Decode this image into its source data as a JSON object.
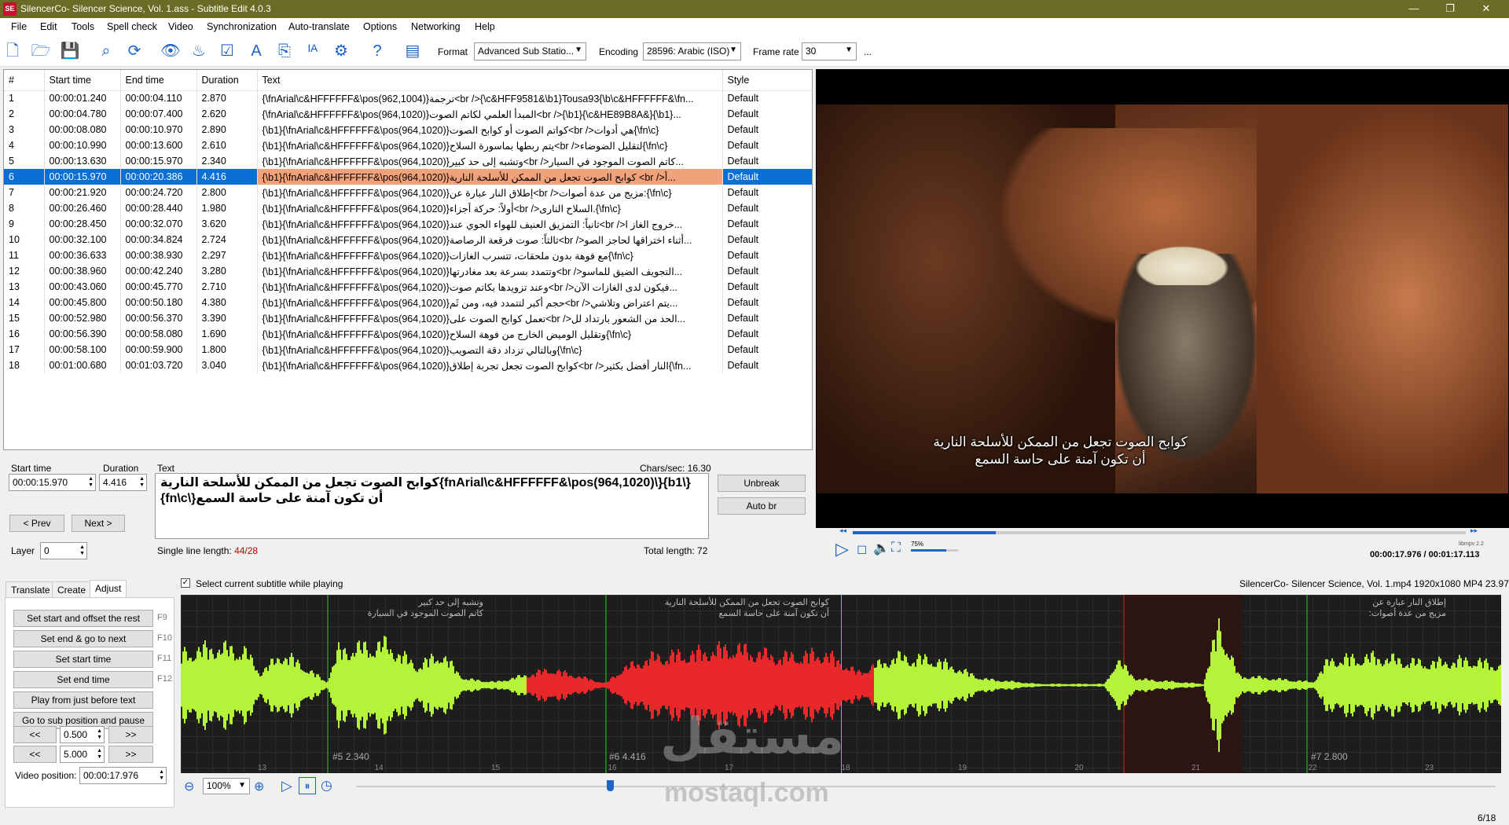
{
  "window": {
    "title": "SilencerCo- Silencer Science, Vol. 1.ass - Subtitle Edit 4.0.3",
    "icon_text": "SE",
    "minimize": "—",
    "maximize": "❐",
    "close": "✕"
  },
  "menu": [
    "File",
    "Edit",
    "Tools",
    "Spell check",
    "Video",
    "Synchronization",
    "Auto-translate",
    "Options",
    "Networking",
    "Help"
  ],
  "toolbar": {
    "format_label": "Format",
    "format_value": "Advanced Sub Statio...",
    "encoding_label": "Encoding",
    "encoding_value": "28596: Arabic (ISO)",
    "framerate_label": "Frame rate",
    "framerate_value": "30",
    "more": "..."
  },
  "grid": {
    "columns": [
      "#",
      "Start time",
      "End time",
      "Duration",
      "Text",
      "Style"
    ],
    "rows": [
      [
        "1",
        "00:00:01.240",
        "00:00:04.110",
        "2.870",
        "{\\fnArial\\c&HFFFFFF&\\pos(962,1004)}ترجمة<br />{\\c&HFF9581&\\b1}Tousa93{\\b\\c&HFFFFFF&\\fn...",
        "Default"
      ],
      [
        "2",
        "00:00:04.780",
        "00:00:07.400",
        "2.620",
        "{\\fnArial\\c&HFFFFFF&\\pos(964,1020)}المبدأ العلمي لكاتم الصوت<br />{\\b1}{\\c&HE89B8A&}{\\b1}...",
        "Default"
      ],
      [
        "3",
        "00:00:08.080",
        "00:00:10.970",
        "2.890",
        "{\\b1}{\\fnArial\\c&HFFFFFF&\\pos(964,1020)}كواتم الصوت أو كوابح الصوت<br />هي أدوات{\\fn\\c}",
        "Default"
      ],
      [
        "4",
        "00:00:10.990",
        "00:00:13.600",
        "2.610",
        "{\\b1}{\\fnArial\\c&HFFFFFF&\\pos(964,1020)}يتم ربطها بماسورة السلاح<br />لتقليل الضوضاء{\\fn\\c}",
        "Default"
      ],
      [
        "5",
        "00:00:13.630",
        "00:00:15.970",
        "2.340",
        "{\\b1}{\\fnArial\\c&HFFFFFF&\\pos(964,1020)}وتشبه إلى حد كبير<br />كاتم الصوت الموجود في السيار...",
        "Default"
      ],
      [
        "6",
        "00:00:15.970",
        "00:00:20.386",
        "4.416",
        "{\\b1}{\\fnArial\\c&HFFFFFF&\\pos(964,1020)}كوابح الصوت تجعل من الممكن للأسلحة النارية <br />أ...",
        "Default"
      ],
      [
        "7",
        "00:00:21.920",
        "00:00:24.720",
        "2.800",
        "{\\b1}{\\fnArial\\c&HFFFFFF&\\pos(964,1020)}إطلاق النار عبارة عن<br />مزيج من عدة أصوات:{\\fn\\c}",
        "Default"
      ],
      [
        "8",
        "00:00:26.460",
        "00:00:28.440",
        "1.980",
        "{\\b1}{\\fnArial\\c&HFFFFFF&\\pos(964,1020)}أولاً: حركة أجزاء<br />السلاح النارى.{\\fn\\c}",
        "Default"
      ],
      [
        "9",
        "00:00:28.450",
        "00:00:32.070",
        "3.620",
        "{\\b1}{\\fnArial\\c&HFFFFFF&\\pos(964,1020)}ثانياً: التمزيق العنيف للهواء الجوي عند<br />خروج الغاز ا...",
        "Default"
      ],
      [
        "10",
        "00:00:32.100",
        "00:00:34.824",
        "2.724",
        "{\\b1}{\\fnArial\\c&HFFFFFF&\\pos(964,1020)}ثالثاً: صوت فرقعة الرصاصة<br />أثناء اختراقها لحاجز الصو...",
        "Default"
      ],
      [
        "11",
        "00:00:36.633",
        "00:00:38.930",
        "2.297",
        "{\\b1}{\\fnArial\\c&HFFFFFF&\\pos(964,1020)}مع فوهة بدون ملحقات، تتسرب الغازات{\\fn\\c}",
        "Default"
      ],
      [
        "12",
        "00:00:38.960",
        "00:00:42.240",
        "3.280",
        "{\\b1}{\\fnArial\\c&HFFFFFF&\\pos(964,1020)}وتتمدد بسرعة بعد مغادرتها<br />التجويف الضيق للماسو...",
        "Default"
      ],
      [
        "13",
        "00:00:43.060",
        "00:00:45.770",
        "2.710",
        "{\\b1}{\\fnArial\\c&HFFFFFF&\\pos(964,1020)}وعند تزويدها بكاتم صوت<br />فيكون لدى الغازات الآن...",
        "Default"
      ],
      [
        "14",
        "00:00:45.800",
        "00:00:50.180",
        "4.380",
        "{\\b1}{\\fnArial\\c&HFFFFFF&\\pos(964,1020)}حجم أكبر لتتمدد فيه، ومن ثَم<br />يتم اعتراض وتلاشي...",
        "Default"
      ],
      [
        "15",
        "00:00:52.980",
        "00:00:56.370",
        "3.390",
        "{\\b1}{\\fnArial\\c&HFFFFFF&\\pos(964,1020)}تعمل كوابح الصوت على<br />الحد من الشعور بارتداد لل...",
        "Default"
      ],
      [
        "16",
        "00:00:56.390",
        "00:00:58.080",
        "1.690",
        "{\\b1}{\\fnArial\\c&HFFFFFF&\\pos(964,1020)}وتقليل الوميض الخارج من فوهة السلاح{\\fn\\c}",
        "Default"
      ],
      [
        "17",
        "00:00:58.100",
        "00:00:59.900",
        "1.800",
        "{\\b1}{\\fnArial\\c&HFFFFFF&\\pos(964,1020)}وبالتالي تزداد دقة التصويب{\\fn\\c}",
        "Default"
      ],
      [
        "18",
        "00:01:00.680",
        "00:01:03.720",
        "3.040",
        "{\\b1}{\\fnArial\\c&HFFFFFF&\\pos(964,1020)}كوابح الصوت تجعل تجربة إطلاق<br />النار أفضل بكثير{\\fn...",
        "Default"
      ]
    ],
    "selected_row_index": 5
  },
  "video": {
    "subtitle_line1": "كوابح الصوت تجعل من الممكن للأسلحة النارية",
    "subtitle_line2": "أن تكون آمنة على حاسة السمع",
    "volume": "75%",
    "engine": "libmpv 2.2",
    "time": "00:00:17.976 / 00:01:17.113",
    "position_fraction": 0.233,
    "volume_fraction": 0.75
  },
  "editor": {
    "start_time_label": "Start time",
    "start_time": "00:00:15.970",
    "duration_label": "Duration",
    "duration": "4.416",
    "text_label": "Text",
    "chars_sec": "Chars/sec: 16.30",
    "text_line1": "{\\b1}{\\fnArial\\c&HFFFFFF&\\pos(964,1020)}كوابح الصوت تجعل من الممكن للأسلحة النارية",
    "text_line2": "أن تكون آمنة على حاسة السمع{\\fn\\c}",
    "prev": "< Prev",
    "next": "Next >",
    "layer_label": "Layer",
    "layer": "0",
    "single_line_label": "Single line length: ",
    "single_line_value": "44/28",
    "total_length": "Total length: 72",
    "unbreak": "Unbreak",
    "auto_br": "Auto br"
  },
  "bottom": {
    "tabs": [
      "Translate",
      "Create",
      "Adjust"
    ],
    "select_current": "Select current subtitle while playing",
    "file_info": "SilencerCo- Silencer Science, Vol. 1.mp4 1920x1080 MP4 23.976",
    "buttons": [
      {
        "label": "Set start and offset the rest",
        "key": "F9"
      },
      {
        "label": "Set end & go to next",
        "key": "F10"
      },
      {
        "label": "Set start time",
        "key": "F11"
      },
      {
        "label": "Set end time",
        "key": "F12"
      },
      {
        "label": "Play from just before text",
        "key": ""
      },
      {
        "label": "Go to sub position and pause",
        "key": ""
      }
    ],
    "step_small": "0.500",
    "step_large": "5.000",
    "back": "<<",
    "fwd": ">>",
    "video_position_label": "Video position:",
    "video_position": "00:00:17.976",
    "zoom": "100%"
  },
  "waveform": {
    "segments": [
      {
        "num": "#5",
        "dur": "2.340",
        "line1": "وتشبه إلى حد كبير",
        "line2": "كاتم الصوت الموجود في السيارة"
      },
      {
        "num": "#6",
        "dur": "4.416",
        "line1": "كوابح الصوت تجعل من الممكن للأسلحة النارية",
        "line2": "أن تكون آمنة على حاسة السمع"
      },
      {
        "num": "#7",
        "dur": "2.800",
        "line1": "إطلاق النار عبارة عن",
        "line2": "مزيج من عدة أصوات:"
      }
    ],
    "ticks": [
      "13",
      "14",
      "15",
      "16",
      "17",
      "18",
      "19",
      "20",
      "21",
      "22",
      "23"
    ]
  },
  "watermark": {
    "ar": "مستقل",
    "en": "mostaql.com"
  },
  "status": {
    "counter": "6/18"
  },
  "colors": {
    "titlebar": "#6b6b26",
    "selection": "#0a6fd6",
    "selected_text_cell": "#f2a27a",
    "wave_green": "#b5f23a",
    "wave_red": "#e8282a",
    "icon_blue": "#1f63c6"
  }
}
